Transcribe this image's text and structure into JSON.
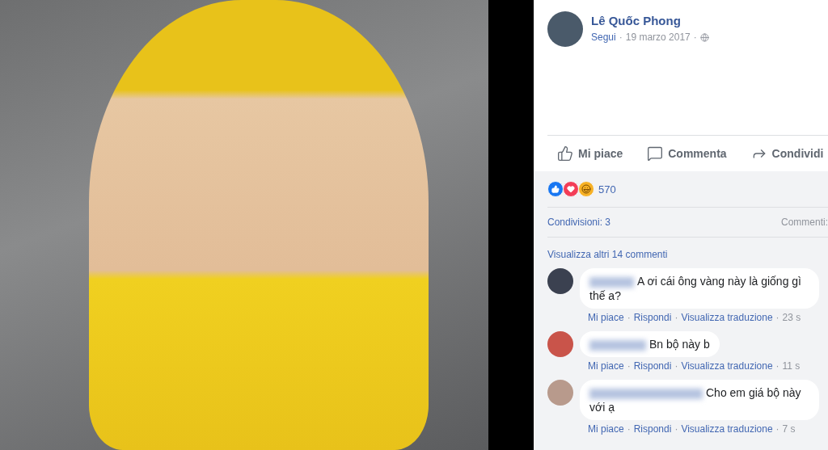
{
  "post": {
    "author": "Lê Quốc Phong",
    "follow": "Segui",
    "date": "19 marzo 2017",
    "separator": "·"
  },
  "actions": [
    {
      "label": "Mi piace",
      "kind": "like"
    },
    {
      "label": "Commenta",
      "kind": "comment"
    },
    {
      "label": "Condividi",
      "kind": "share"
    }
  ],
  "reactions": {
    "count": "570"
  },
  "shares": "Condivisioni: 3",
  "comments_count": "Commenti:",
  "more_comments": "Visualizza altri 14 commenti",
  "comments": [
    {
      "text": "A ơi cái ông vàng này là giống gì thế a?",
      "links": [
        "Mi piace",
        "Rispondi",
        "Visualizza traduzione"
      ],
      "time": "23 s"
    },
    {
      "text": "Bn bộ này b",
      "links": [
        "Mi piace",
        "Rispondi",
        "Visualizza traduzione"
      ],
      "time": "11 s"
    },
    {
      "text": "Cho em giá bộ này với ạ",
      "links": [
        "Mi piace",
        "Rispondi",
        "Visualizza traduzione"
      ],
      "time": "7 s"
    }
  ]
}
